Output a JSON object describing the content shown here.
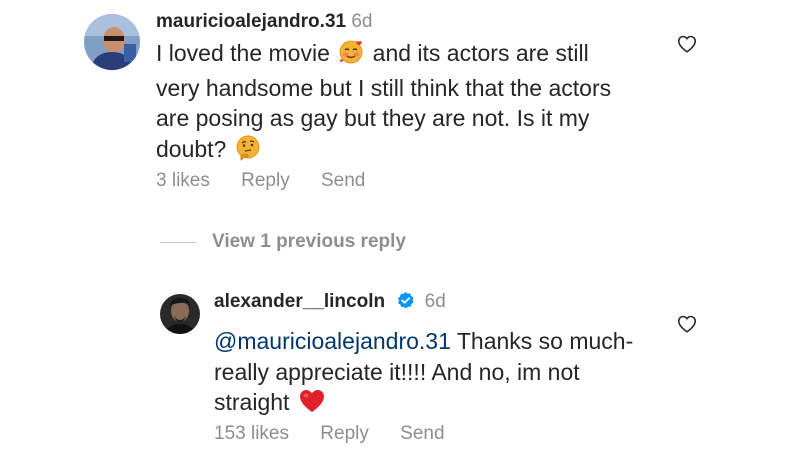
{
  "comment1": {
    "username": "mauricioalejandro.31",
    "time": "6d",
    "text_part1": "I loved the movie",
    "emoji1": "smiling-face-with-hearts",
    "text_part2": "and its actors are still very handsome but I still think that the actors are posing as gay but they are not. Is it my doubt?",
    "emoji2": "thinking-face",
    "likes": "3 likes",
    "reply_label": "Reply",
    "send_label": "Send"
  },
  "thread": {
    "view_previous_label": "View 1 previous reply"
  },
  "comment2": {
    "username": "alexander__lincoln",
    "verified": true,
    "time": "6d",
    "mention": "@mauricioalejandro.31",
    "text": "Thanks so much- really appreciate it!!!! And no, im not straight",
    "emoji": "red-heart",
    "likes": "153 likes",
    "reply_label": "Reply",
    "send_label": "Send"
  },
  "colors": {
    "primary_text": "#262626",
    "secondary_text": "#8e8e8e",
    "mention": "#00376b",
    "verified": "#0095f6",
    "heart_emoji": "#e0202a"
  }
}
